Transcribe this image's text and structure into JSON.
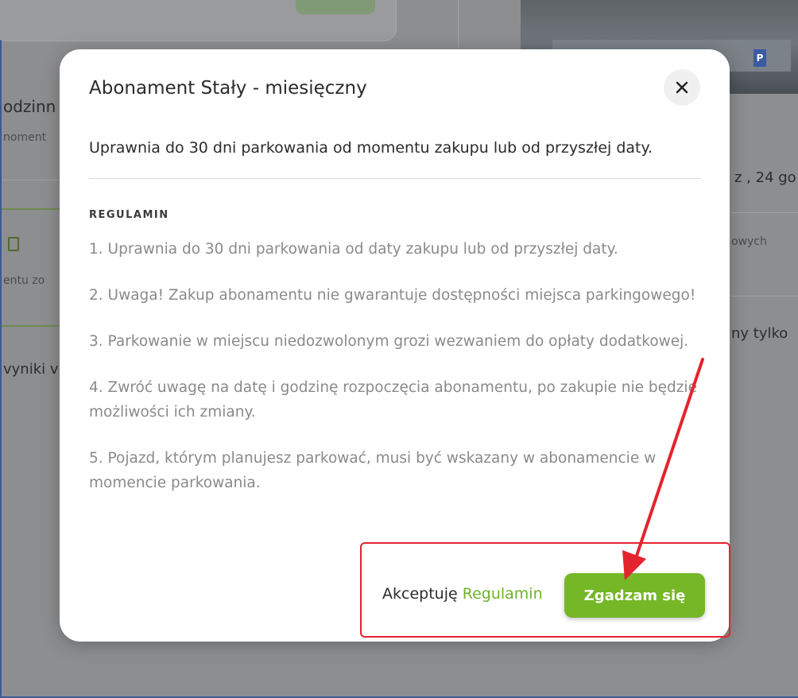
{
  "background": {
    "snippet_left_1": "odzinn",
    "snippet_left_2": "noment",
    "snippet_left_3": "entu zo",
    "snippet_left_4": "vyniki v",
    "snippet_right_1": "z , 24 go",
    "snippet_right_2": "owych",
    "snippet_right_3": "ny tylko"
  },
  "modal": {
    "title": "Abonament Stały - miesięczny",
    "description": "Uprawnia do 30 dni parkowania od momentu zakupu lub od przyszłej daty.",
    "terms_heading": "REGULAMIN",
    "terms": [
      "1. Uprawnia do 30 dni parkowania od daty zakupu lub od przyszłej daty.",
      "2. Uwaga! Zakup abonamentu nie gwarantuje dostępności miejsca parkingowego!",
      "3. Parkowanie w miejscu niedozwolonym grozi wezwaniem do opłaty dodatkowej.",
      "4. Zwróć uwagę na datę i godzinę rozpoczęcia abonamentu, po zakupie nie będzie możliwości ich zmiany.",
      "5. Pojazd, którym planujesz parkować, musi być wskazany w abonamencie w momencie parkowania."
    ],
    "accept_prefix": "Akceptuję",
    "accept_link": "Regulamin",
    "agree_button": "Zgadzam się"
  },
  "colors": {
    "accent_green": "#75b726",
    "annotation_red": "#e4232e"
  }
}
